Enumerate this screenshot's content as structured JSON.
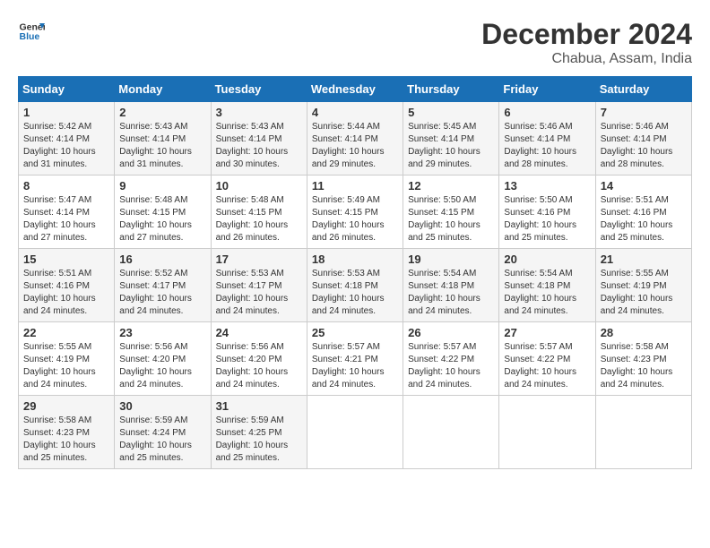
{
  "header": {
    "logo_line1": "General",
    "logo_line2": "Blue",
    "month": "December 2024",
    "location": "Chabua, Assam, India"
  },
  "days_of_week": [
    "Sunday",
    "Monday",
    "Tuesday",
    "Wednesday",
    "Thursday",
    "Friday",
    "Saturday"
  ],
  "weeks": [
    [
      {
        "day": "1",
        "sunrise": "5:42 AM",
        "sunset": "4:14 PM",
        "daylight": "10 hours and 31 minutes."
      },
      {
        "day": "2",
        "sunrise": "5:43 AM",
        "sunset": "4:14 PM",
        "daylight": "10 hours and 31 minutes."
      },
      {
        "day": "3",
        "sunrise": "5:43 AM",
        "sunset": "4:14 PM",
        "daylight": "10 hours and 30 minutes."
      },
      {
        "day": "4",
        "sunrise": "5:44 AM",
        "sunset": "4:14 PM",
        "daylight": "10 hours and 29 minutes."
      },
      {
        "day": "5",
        "sunrise": "5:45 AM",
        "sunset": "4:14 PM",
        "daylight": "10 hours and 29 minutes."
      },
      {
        "day": "6",
        "sunrise": "5:46 AM",
        "sunset": "4:14 PM",
        "daylight": "10 hours and 28 minutes."
      },
      {
        "day": "7",
        "sunrise": "5:46 AM",
        "sunset": "4:14 PM",
        "daylight": "10 hours and 28 minutes."
      }
    ],
    [
      {
        "day": "8",
        "sunrise": "5:47 AM",
        "sunset": "4:14 PM",
        "daylight": "10 hours and 27 minutes."
      },
      {
        "day": "9",
        "sunrise": "5:48 AM",
        "sunset": "4:15 PM",
        "daylight": "10 hours and 27 minutes."
      },
      {
        "day": "10",
        "sunrise": "5:48 AM",
        "sunset": "4:15 PM",
        "daylight": "10 hours and 26 minutes."
      },
      {
        "day": "11",
        "sunrise": "5:49 AM",
        "sunset": "4:15 PM",
        "daylight": "10 hours and 26 minutes."
      },
      {
        "day": "12",
        "sunrise": "5:50 AM",
        "sunset": "4:15 PM",
        "daylight": "10 hours and 25 minutes."
      },
      {
        "day": "13",
        "sunrise": "5:50 AM",
        "sunset": "4:16 PM",
        "daylight": "10 hours and 25 minutes."
      },
      {
        "day": "14",
        "sunrise": "5:51 AM",
        "sunset": "4:16 PM",
        "daylight": "10 hours and 25 minutes."
      }
    ],
    [
      {
        "day": "15",
        "sunrise": "5:51 AM",
        "sunset": "4:16 PM",
        "daylight": "10 hours and 24 minutes."
      },
      {
        "day": "16",
        "sunrise": "5:52 AM",
        "sunset": "4:17 PM",
        "daylight": "10 hours and 24 minutes."
      },
      {
        "day": "17",
        "sunrise": "5:53 AM",
        "sunset": "4:17 PM",
        "daylight": "10 hours and 24 minutes."
      },
      {
        "day": "18",
        "sunrise": "5:53 AM",
        "sunset": "4:18 PM",
        "daylight": "10 hours and 24 minutes."
      },
      {
        "day": "19",
        "sunrise": "5:54 AM",
        "sunset": "4:18 PM",
        "daylight": "10 hours and 24 minutes."
      },
      {
        "day": "20",
        "sunrise": "5:54 AM",
        "sunset": "4:18 PM",
        "daylight": "10 hours and 24 minutes."
      },
      {
        "day": "21",
        "sunrise": "5:55 AM",
        "sunset": "4:19 PM",
        "daylight": "10 hours and 24 minutes."
      }
    ],
    [
      {
        "day": "22",
        "sunrise": "5:55 AM",
        "sunset": "4:19 PM",
        "daylight": "10 hours and 24 minutes."
      },
      {
        "day": "23",
        "sunrise": "5:56 AM",
        "sunset": "4:20 PM",
        "daylight": "10 hours and 24 minutes."
      },
      {
        "day": "24",
        "sunrise": "5:56 AM",
        "sunset": "4:20 PM",
        "daylight": "10 hours and 24 minutes."
      },
      {
        "day": "25",
        "sunrise": "5:57 AM",
        "sunset": "4:21 PM",
        "daylight": "10 hours and 24 minutes."
      },
      {
        "day": "26",
        "sunrise": "5:57 AM",
        "sunset": "4:22 PM",
        "daylight": "10 hours and 24 minutes."
      },
      {
        "day": "27",
        "sunrise": "5:57 AM",
        "sunset": "4:22 PM",
        "daylight": "10 hours and 24 minutes."
      },
      {
        "day": "28",
        "sunrise": "5:58 AM",
        "sunset": "4:23 PM",
        "daylight": "10 hours and 24 minutes."
      }
    ],
    [
      {
        "day": "29",
        "sunrise": "5:58 AM",
        "sunset": "4:23 PM",
        "daylight": "10 hours and 25 minutes."
      },
      {
        "day": "30",
        "sunrise": "5:59 AM",
        "sunset": "4:24 PM",
        "daylight": "10 hours and 25 minutes."
      },
      {
        "day": "31",
        "sunrise": "5:59 AM",
        "sunset": "4:25 PM",
        "daylight": "10 hours and 25 minutes."
      },
      null,
      null,
      null,
      null
    ]
  ]
}
